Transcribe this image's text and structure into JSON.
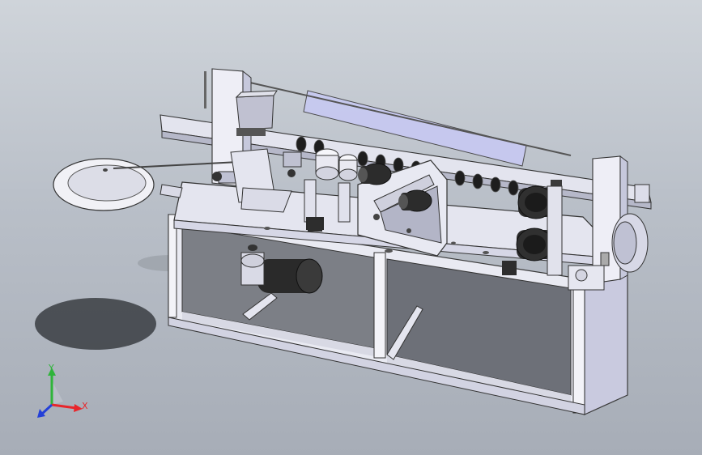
{
  "triad": {
    "x_label": "X",
    "y_label": "Y",
    "z_label": "",
    "x_color": "#e8262b",
    "y_color": "#2fb43a",
    "z_color": "#2440d8"
  },
  "palette": {
    "background_top": "#cfd4da",
    "background_bottom": "#a7adb7",
    "panel_face": "#ecedf4",
    "panel_side": "#cacbe0",
    "frame_edge": "#3a3a3a",
    "motor_dark": "#2c2c2c",
    "shadow": "#3a3d42"
  }
}
